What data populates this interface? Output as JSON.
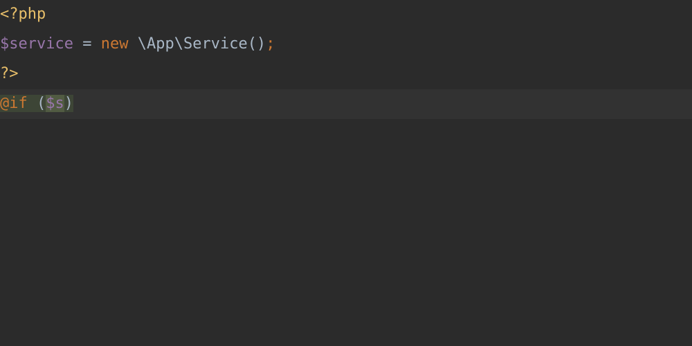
{
  "editor": {
    "line1": {
      "phpOpen": "<?php"
    },
    "line2": {
      "variable": "$service",
      "space1": " ",
      "equals": "=",
      "space2": " ",
      "newKeyword": "new",
      "space3": " ",
      "backslash1": "\\",
      "namespace": "App",
      "backslash2": "\\",
      "classname": "Service",
      "parens": "()",
      "semicolon": ";"
    },
    "line3": {
      "phpClose": "?>"
    },
    "line4": {
      "directive": "@if",
      "space": " ",
      "openParen": "(",
      "dollarS": "$s",
      "closeParen": ")"
    }
  }
}
